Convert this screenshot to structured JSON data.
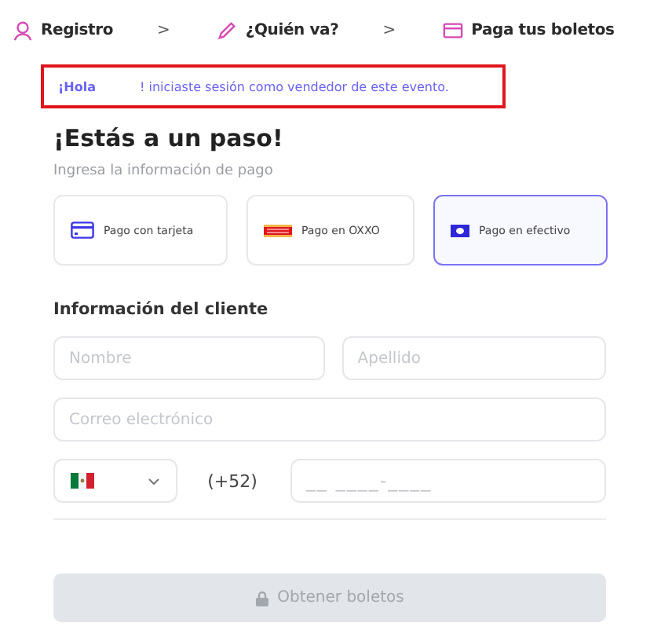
{
  "steps": [
    {
      "label": "Registro",
      "kind": "user",
      "separator": ">"
    },
    {
      "label": "¿Quién va?",
      "kind": "pencil",
      "separator": ">"
    },
    {
      "label": "Paga tus boletos",
      "kind": "card"
    }
  ],
  "banner": {
    "greeting": "¡Hola",
    "message": "! iniciaste sesión como vendedor de este evento."
  },
  "title": "¡Estás a un paso!",
  "subtitle": "Ingresa la información de pago",
  "payment_methods": [
    {
      "label": "Pago con tarjeta",
      "kind": "card",
      "selected": false
    },
    {
      "label": "Pago en OXXO",
      "kind": "oxxo",
      "selected": false
    },
    {
      "label": "Pago en efectivo",
      "kind": "cash",
      "selected": true
    }
  ],
  "customer_section": "Información del cliente",
  "fields": {
    "first_name": {
      "placeholder": "Nombre"
    },
    "last_name": {
      "placeholder": "Apellido"
    },
    "email": {
      "placeholder": "Correo electrónico"
    },
    "dial_code": "(+52)",
    "phone": {
      "placeholder": "__ ____-____"
    }
  },
  "submit": {
    "label": "Obtener boletos",
    "disabled": true
  }
}
